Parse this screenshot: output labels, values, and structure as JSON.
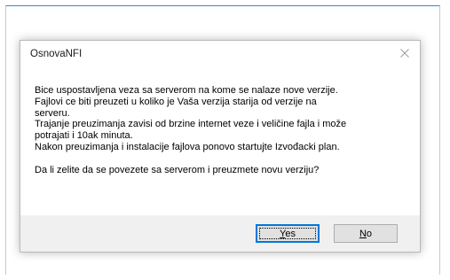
{
  "dialog": {
    "title": "OsnovaNFI",
    "close_icon": "close-icon",
    "message_lines": [
      "Bice uspostavljena veza sa serverom na kome se nalaze nove verzije.",
      "Fajlovi ce biti preuzeti u koliko je Vaša verzija starija od verzije na",
      "serveru.",
      "Trajanje preuzimanja zavisi od brzine internet veze i veličine fajla i može",
      "potrajati i 10ak minuta.",
      "Nakon preuzimanja i instalacije fajlova ponovo startujte Izvođacki plan."
    ],
    "question": "Da li zelite da se povezete sa serverom i preuzmete novu verziju?",
    "buttons": {
      "yes": {
        "mnemonic": "Y",
        "rest": "es"
      },
      "no": {
        "mnemonic": "N",
        "rest": "o"
      }
    }
  },
  "colors": {
    "accent": "#0078d7",
    "footer_bg": "#f0f0f0",
    "button_bg": "#e1e1e1",
    "window_border_accent": "#2b8fd6"
  }
}
